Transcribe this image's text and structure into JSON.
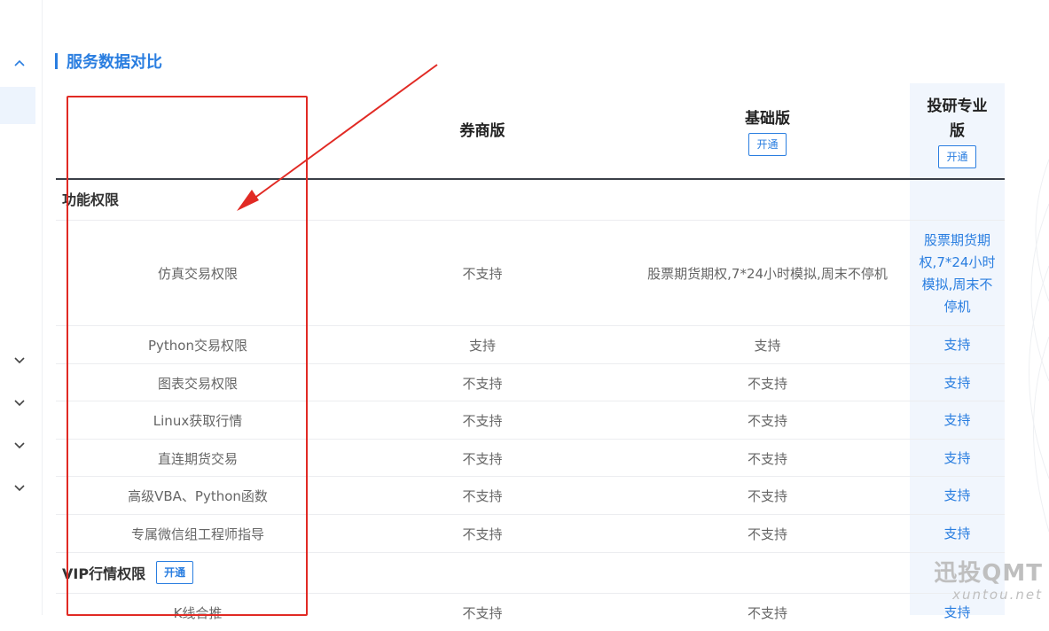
{
  "section": {
    "title": "服务数据对比"
  },
  "columns": [
    {
      "label": "券商版"
    },
    {
      "label": "基础版",
      "button": "开通"
    },
    {
      "label_line1": "投研专业",
      "label_line2": "版",
      "button": "开通"
    }
  ],
  "groups": [
    {
      "title": "功能权限",
      "rows": [
        {
          "name": "仿真交易权限",
          "broker": "不支持",
          "basic": "股票期货期权,7*24小时模拟,周末不停机",
          "pro_lines": [
            "股票期货期",
            "权,7*24小时",
            "模拟,周末不",
            "停机"
          ]
        },
        {
          "name": "Python交易权限",
          "broker": "支持",
          "basic": "支持",
          "pro": "支持"
        },
        {
          "name": "图表交易权限",
          "broker": "不支持",
          "basic": "不支持",
          "pro": "支持"
        },
        {
          "name": "Linux获取行情",
          "broker": "不支持",
          "basic": "不支持",
          "pro": "支持"
        },
        {
          "name": "直连期货交易",
          "broker": "不支持",
          "basic": "不支持",
          "pro": "支持"
        },
        {
          "name": "高级VBA、Python函数",
          "broker": "不支持",
          "basic": "不支持",
          "pro": "支持"
        },
        {
          "name": "专属微信组工程师指导",
          "broker": "不支持",
          "basic": "不支持",
          "pro": "支持"
        }
      ]
    },
    {
      "title": "VIP行情权限",
      "button": "开通",
      "rows": [
        {
          "name": "K线合推",
          "broker": "不支持",
          "basic": "不支持",
          "pro": "支持"
        }
      ]
    }
  ],
  "watermark": {
    "main": "迅投QMT",
    "sub": "xuntou.net"
  },
  "colors": {
    "accent": "#2a7ee0",
    "annotation": "#e12a24",
    "pro_column_bg": "#f1f6fd"
  },
  "icons": {
    "sidebar_top": "chevron-up-icon",
    "sidebar_items": "chevron-down-icon"
  }
}
